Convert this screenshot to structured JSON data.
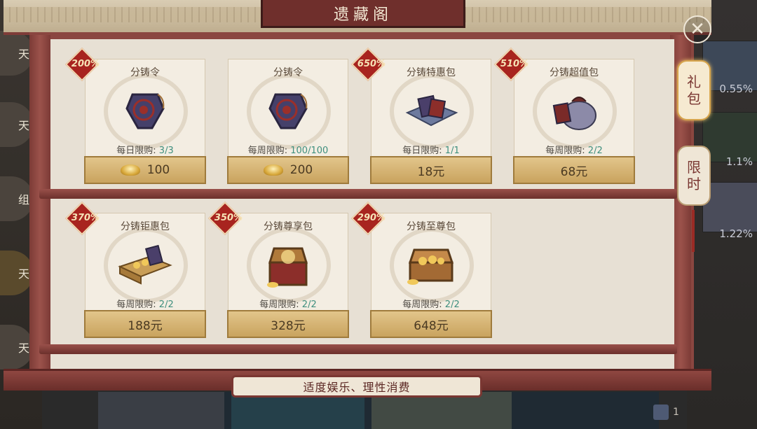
{
  "title": "遗藏阁",
  "notice": "适度娱乐、理性消费",
  "side_tabs": [
    {
      "label_lines": [
        "礼",
        "包"
      ],
      "active": true
    },
    {
      "label_lines": [
        "限",
        "时"
      ],
      "active": false
    }
  ],
  "background": {
    "left_tags": [
      "天",
      "天",
      "组",
      "天",
      "天"
    ],
    "right_percents": [
      "0.55%",
      "1.1%",
      "1.22%"
    ],
    "bottom_count": "1"
  },
  "items": [
    {
      "name": "分铸令",
      "badge": "200%",
      "limit_label": "每日限购:",
      "limit_count": "3/3",
      "price": "100",
      "currency": "gold-ingot",
      "icon": "token-icon"
    },
    {
      "name": "分铸令",
      "badge": "",
      "limit_label": "每周限购:",
      "limit_count": "100/100",
      "price": "200",
      "currency": "gold-ingot",
      "icon": "token-icon"
    },
    {
      "name": "分铸特惠包",
      "badge": "650%",
      "limit_label": "每日限购:",
      "limit_count": "1/1",
      "price": "18元",
      "currency": "rmb",
      "icon": "cloth-bundle-icon"
    },
    {
      "name": "分铸超值包",
      "badge": "510%",
      "limit_label": "每周限购:",
      "limit_count": "2/2",
      "price": "68元",
      "currency": "rmb",
      "icon": "sack-icon"
    },
    {
      "name": "分铸钜惠包",
      "badge": "370%",
      "limit_label": "每周限购:",
      "limit_count": "2/2",
      "price": "188元",
      "currency": "rmb",
      "icon": "gold-box-icon"
    },
    {
      "name": "分铸尊享包",
      "badge": "350%",
      "limit_label": "每周限购:",
      "limit_count": "2/2",
      "price": "328元",
      "currency": "rmb",
      "icon": "treasure-chest-icon"
    },
    {
      "name": "分铸至尊包",
      "badge": "290%",
      "limit_label": "每周限购:",
      "limit_count": "2/2",
      "price": "648元",
      "currency": "rmb",
      "icon": "gold-chest-icon"
    }
  ]
}
